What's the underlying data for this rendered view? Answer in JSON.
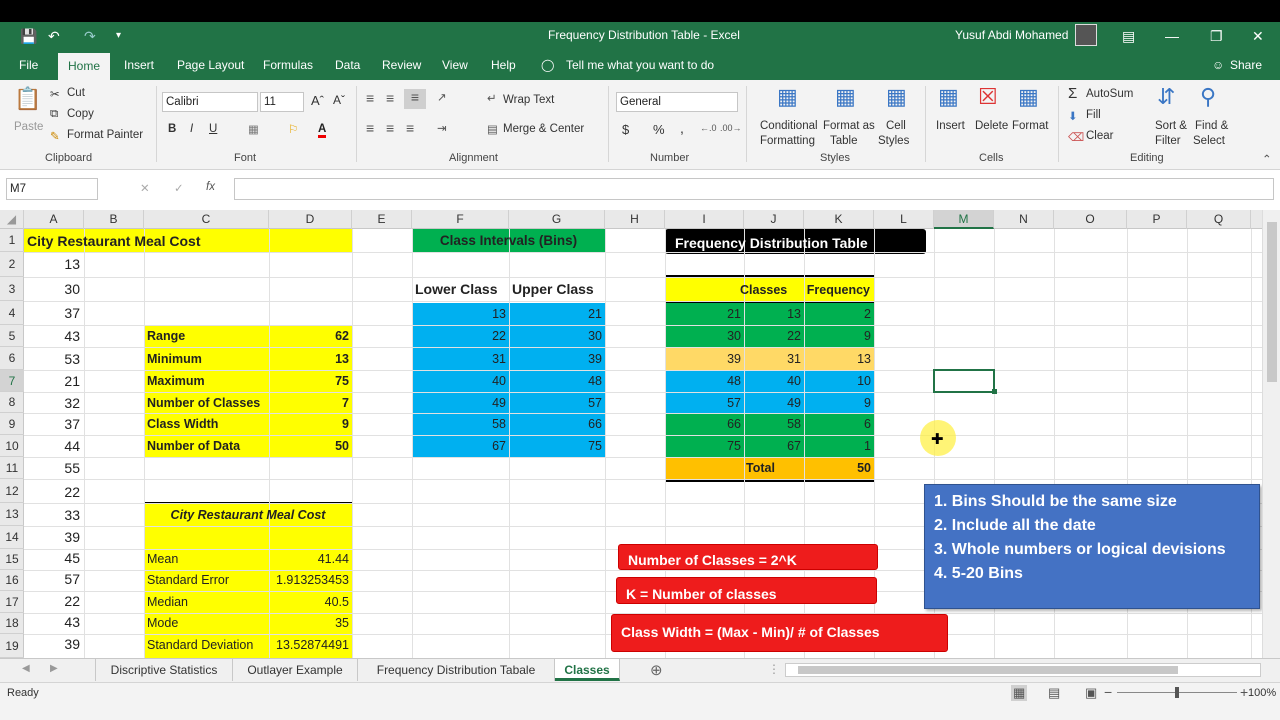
{
  "window": {
    "title": "Frequency Distribution Table  -  Excel",
    "user": "Yusuf Abdi Mohamed"
  },
  "menu": {
    "file": "File",
    "tabs": [
      "Home",
      "Insert",
      "Page Layout",
      "Formulas",
      "Data",
      "Review",
      "View",
      "Help"
    ],
    "tell": "Tell me what you want to do",
    "share": "Share"
  },
  "ribbon": {
    "clipboard": {
      "paste": "Paste",
      "cut": "Cut",
      "copy": "Copy",
      "format_painter": "Format Painter",
      "label": "Clipboard"
    },
    "font": {
      "name": "Calibri",
      "size": "11",
      "bold": "B",
      "italic": "I",
      "underline": "U",
      "label": "Font"
    },
    "alignment": {
      "wrap": "Wrap Text",
      "merge": "Merge & Center",
      "label": "Alignment"
    },
    "number": {
      "format": "General",
      "dollar": "$",
      "percent": "%",
      "comma": ",",
      "label": "Number"
    },
    "styles": {
      "cond1": "Conditional",
      "cond2": "Formatting",
      "fmt1": "Format as",
      "fmt2": "Table",
      "cell1": "Cell",
      "cell2": "Styles",
      "label": "Styles"
    },
    "cells": {
      "insert": "Insert",
      "delete": "Delete",
      "format": "Format",
      "label": "Cells"
    },
    "editing": {
      "autosum": "AutoSum",
      "fill": "Fill",
      "clear": "Clear",
      "sort1": "Sort &",
      "sort2": "Filter",
      "find1": "Find &",
      "find2": "Select",
      "label": "Editing"
    }
  },
  "formula_bar": {
    "name_box": "M7",
    "fx": "fx",
    "content": ""
  },
  "columns": [
    "A",
    "B",
    "C",
    "D",
    "E",
    "F",
    "G",
    "H",
    "I",
    "J",
    "K",
    "L",
    "M",
    "N",
    "O",
    "P",
    "Q"
  ],
  "rows": [
    "1",
    "2",
    "3",
    "4",
    "5",
    "6",
    "7",
    "8",
    "9",
    "10",
    "11",
    "12",
    "13",
    "14",
    "15",
    "16",
    "17",
    "18",
    "19"
  ],
  "sheet": {
    "a_title": "City Restaurant Meal Cost",
    "a_values": [
      "13",
      "30",
      "37",
      "43",
      "53",
      "21",
      "32",
      "37",
      "44",
      "55",
      "22",
      "33",
      "39",
      "45",
      "57",
      "22",
      "43",
      "39"
    ],
    "stats": [
      {
        "label": "Range",
        "value": "62"
      },
      {
        "label": "Minimum",
        "value": "13"
      },
      {
        "label": "Maximum",
        "value": "75"
      },
      {
        "label": "Number of Classes",
        "value": "7"
      },
      {
        "label": "Class Width",
        "value": "9"
      },
      {
        "label": "Number of Data",
        "value": "50"
      }
    ],
    "desc_title": "City Restaurant Meal Cost",
    "desc": [
      {
        "label": "Mean",
        "value": "41.44"
      },
      {
        "label": "Standard Error",
        "value": "1.913253453"
      },
      {
        "label": "Median",
        "value": "40.5"
      },
      {
        "label": "Mode",
        "value": "35"
      },
      {
        "label": "Standard Deviation",
        "value": "13.52874491"
      }
    ],
    "bins_title": "Class Intervals (Bins)",
    "bins_hdr": {
      "lower": "Lower Class",
      "upper": "Upper Class"
    },
    "bins": [
      [
        "13",
        "21"
      ],
      [
        "22",
        "30"
      ],
      [
        "31",
        "39"
      ],
      [
        "40",
        "48"
      ],
      [
        "49",
        "57"
      ],
      [
        "58",
        "66"
      ],
      [
        "67",
        "75"
      ]
    ],
    "freq_title": "Frequency Distribution Table",
    "freq_hdr": {
      "classes": "Classes",
      "frequency": "Frequency"
    },
    "freq": [
      [
        "21",
        "13",
        "2"
      ],
      [
        "30",
        "22",
        "9"
      ],
      [
        "39",
        "31",
        "13"
      ],
      [
        "48",
        "40",
        "10"
      ],
      [
        "57",
        "49",
        "9"
      ],
      [
        "66",
        "58",
        "6"
      ],
      [
        "75",
        "67",
        "1"
      ]
    ],
    "freq_total": {
      "label": "Total",
      "value": "50"
    },
    "notes": [
      "Number of Classes = 2^K",
      "K = Number of classes",
      "Class Width = (Max - Min)/ # of Classes"
    ],
    "rules": [
      "1.  Bins Should be the same size",
      "2. Include all the date",
      "3. Whole numbers or logical devisions",
      "4.  5-20  Bins"
    ]
  },
  "colors": {
    "green": "#217346",
    "yellow": "#ffff00",
    "blue": "#00b0f0",
    "dgreen": "#00b050",
    "orange": "#ffc000",
    "peach": "#ffd966",
    "red": "#ee1c1c",
    "note_blue": "#4472c4"
  },
  "sheet_tabs": [
    "Discriptive Statistics",
    "Outlayer Example",
    "Frequency Distribution Tabale",
    "Classes"
  ],
  "status": {
    "ready": "Ready",
    "zoom": "100%"
  }
}
